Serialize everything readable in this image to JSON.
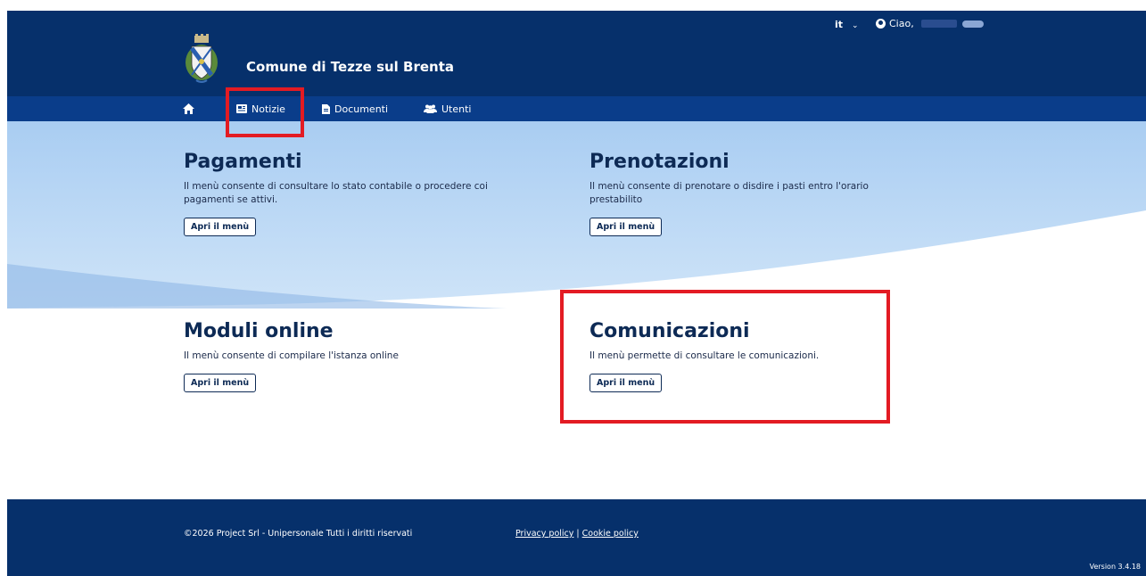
{
  "header": {
    "language": "it",
    "greeting": "Ciao,",
    "site_title": "Comune di Tezze sul Brenta"
  },
  "nav": {
    "items": [
      {
        "label": "Notizie",
        "icon": "newspaper-icon"
      },
      {
        "label": "Documenti",
        "icon": "document-icon"
      },
      {
        "label": "Utenti",
        "icon": "users-icon"
      }
    ],
    "home_icon": "home-icon"
  },
  "cards": {
    "pagamenti": {
      "title": "Pagamenti",
      "desc": "Il menù consente di consultare lo stato contabile o procedere coi pagamenti se attivi.",
      "button": "Apri il menù"
    },
    "prenotazioni": {
      "title": "Prenotazioni",
      "desc": "Il menù consente di prenotare o disdire i pasti entro l'orario prestabilito",
      "button": "Apri il menù"
    },
    "moduli": {
      "title": "Moduli online",
      "desc": "Il menù consente di compilare l'istanza online",
      "button": "Apri il menù"
    },
    "comunicazioni": {
      "title": "Comunicazioni",
      "desc": "Il menù permette di consultare le comunicazioni.",
      "button": "Apri il menù"
    }
  },
  "footer": {
    "copyright": "©2026 Project Srl - Unipersonale Tutti i diritti riservati",
    "privacy": "Privacy policy",
    "separator": " | ",
    "cookie": "Cookie policy",
    "version": "Version 3.4.18"
  },
  "colors": {
    "header_bg": "#06306b",
    "nav_bg": "#0a3d8a",
    "hero_light": "#c9e1f8",
    "highlight": "#e31b23"
  }
}
